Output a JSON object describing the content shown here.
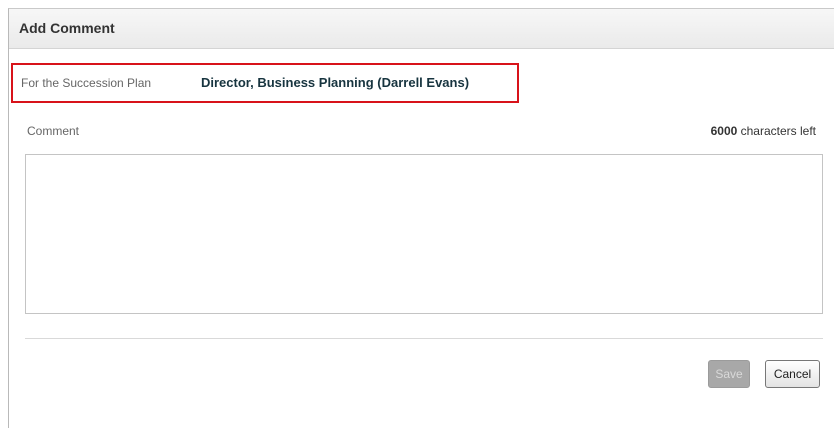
{
  "dialog": {
    "title": "Add Comment"
  },
  "plan": {
    "label": "For the Succession Plan",
    "value": "Director, Business Planning (Darrell Evans)"
  },
  "comment": {
    "label": "Comment",
    "chars_left_count": "6000",
    "chars_left_suffix": " characters left",
    "value": ""
  },
  "buttons": {
    "save_label": "Save",
    "cancel_label": "Cancel"
  },
  "colors": {
    "highlight_border": "#d8131a",
    "plan_value_text": "#17343f",
    "save_disabled_bg": "#a8a8a8"
  }
}
